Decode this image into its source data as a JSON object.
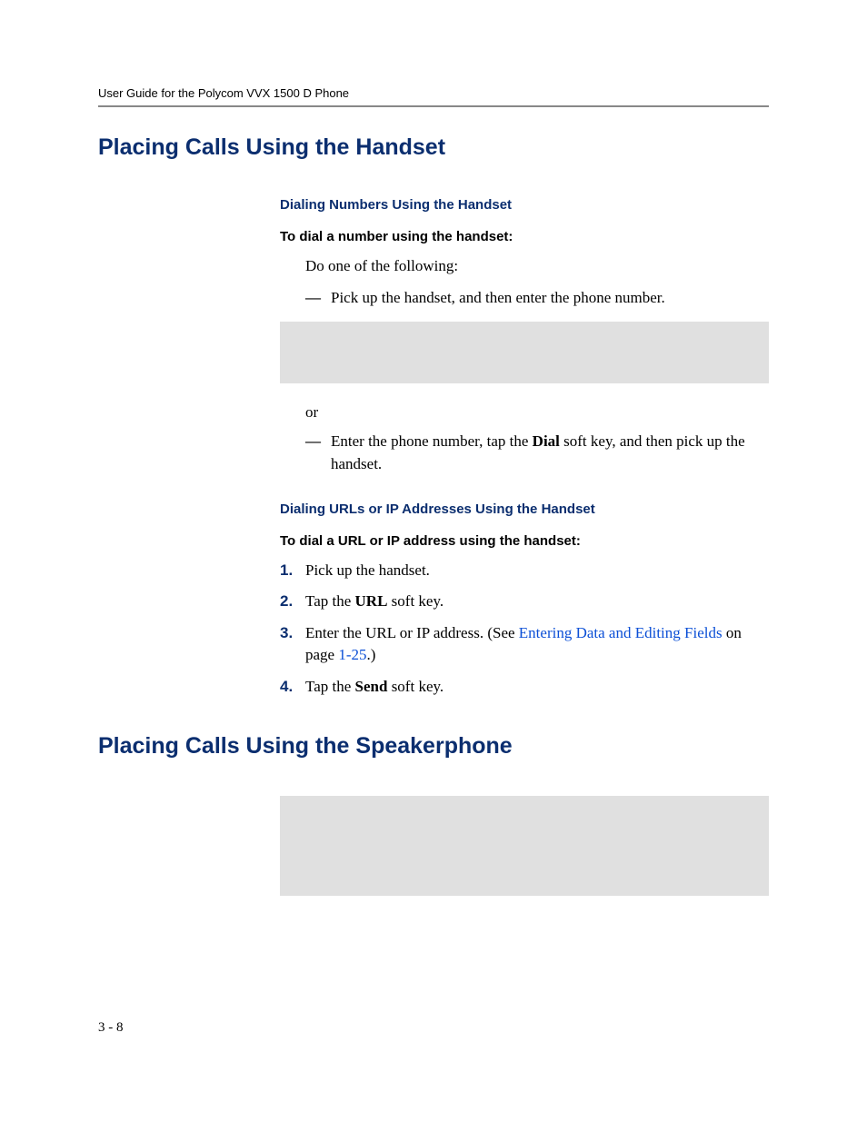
{
  "header": {
    "running": "User Guide for the Polycom VVX 1500 D Phone"
  },
  "section1": {
    "title": "Placing Calls Using the Handset",
    "sub1": {
      "title": "Dialing Numbers Using the Handset",
      "lead": "To dial a number using the handset:",
      "intro": "Do one of the following:",
      "bullet1": "Pick up the handset, and then enter the phone number.",
      "or": "or",
      "bullet2_pre": "Enter the phone number, tap the ",
      "bullet2_bold": "Dial",
      "bullet2_post": " soft key, and then pick up the handset."
    },
    "sub2": {
      "title": "Dialing URLs or IP Addresses Using the Handset",
      "lead": "To dial a URL or IP address using the handset:",
      "steps": {
        "s1": "Pick up the handset.",
        "s2_pre": "Tap the ",
        "s2_bold": "URL",
        "s2_post": " soft key.",
        "s3_pre": "Enter the URL or IP address. (See ",
        "s3_link": "Entering Data and Editing Fields",
        "s3_mid": " on page ",
        "s3_pagelink": "1-25",
        "s3_post": ".)",
        "s4_pre": "Tap the ",
        "s4_bold": "Send",
        "s4_post": " soft key."
      },
      "nums": {
        "n1": "1.",
        "n2": "2.",
        "n3": "3.",
        "n4": "4."
      }
    }
  },
  "section2": {
    "title": "Placing Calls Using the Speakerphone"
  },
  "footer": {
    "pagenum": "3 - 8"
  },
  "glyphs": {
    "dash": "—"
  }
}
